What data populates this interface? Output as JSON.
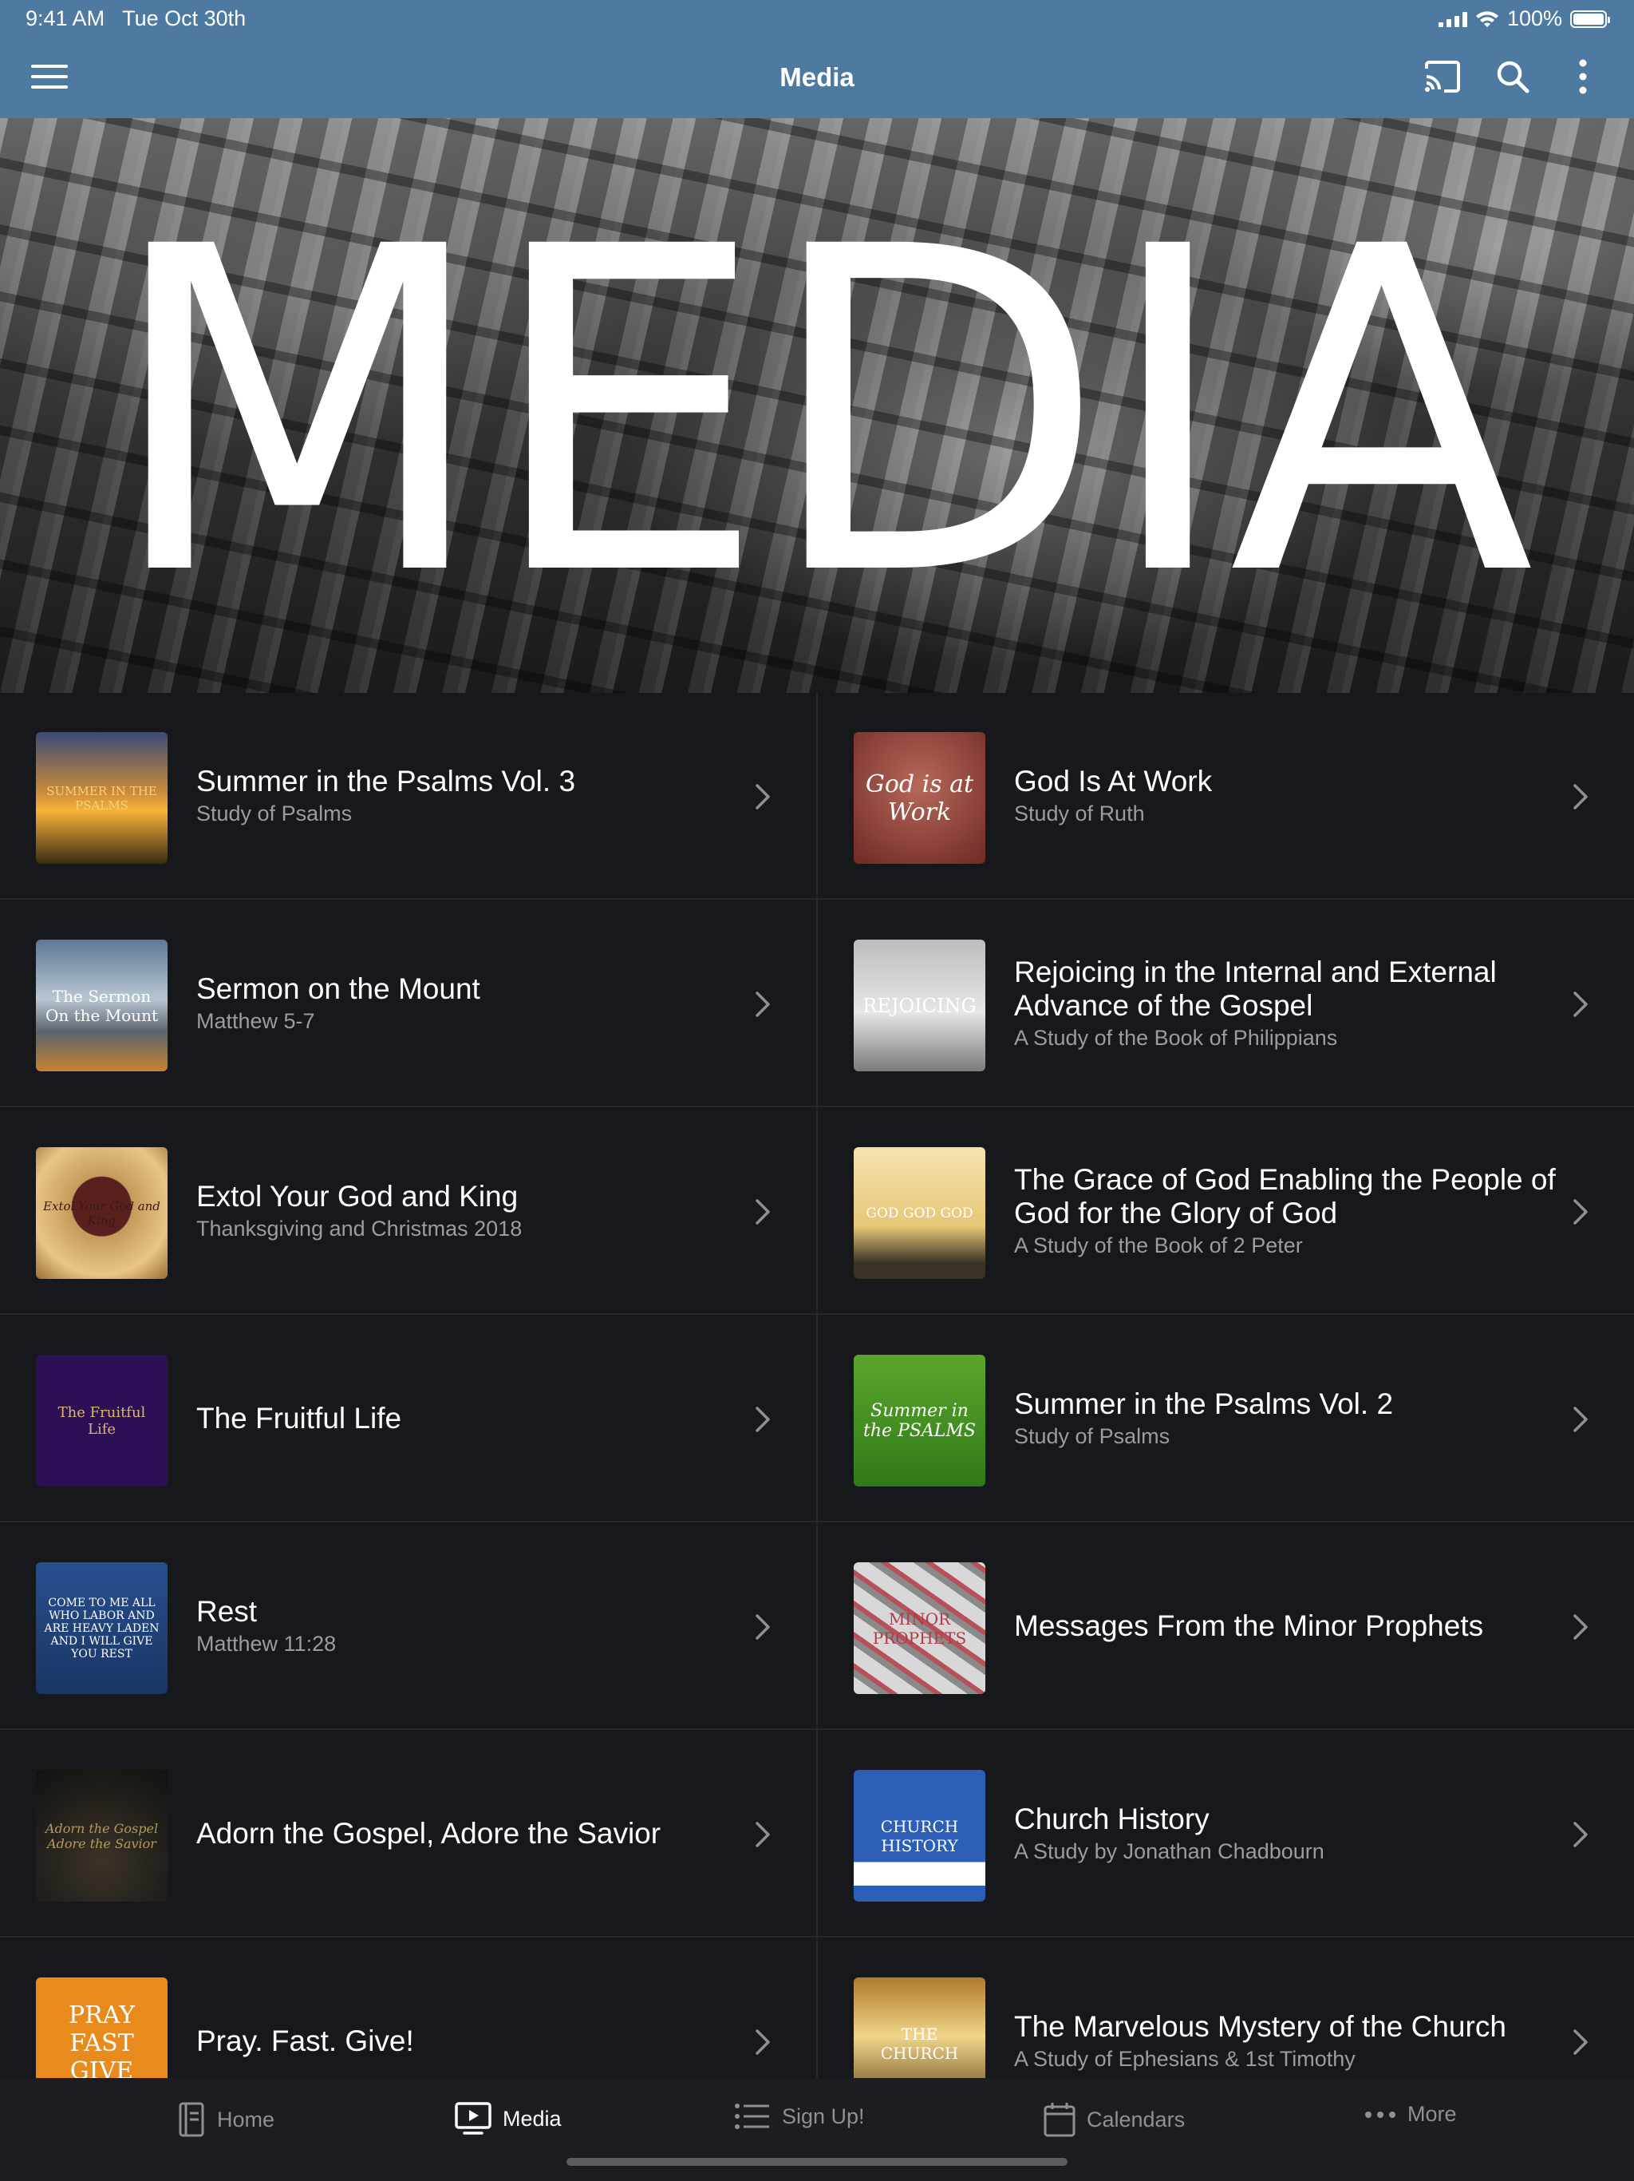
{
  "status": {
    "time": "9:41 AM",
    "date": "Tue Oct 30th",
    "battery": "100%",
    "battery_level": 1.0
  },
  "nav": {
    "title": "Media"
  },
  "hero": {
    "text": "MEDIA"
  },
  "items": [
    {
      "title": "Summer in the Psalms Vol. 3",
      "subtitle": "Study of Psalms",
      "thumb_text": "SUMMER IN THE PSALMS"
    },
    {
      "title": "God Is At Work",
      "subtitle": "Study of Ruth",
      "thumb_text": "God is at Work"
    },
    {
      "title": "Sermon on the Mount",
      "subtitle": "Matthew 5-7",
      "thumb_text": "The Sermon On the Mount"
    },
    {
      "title": "Rejoicing in the Internal and External Advance of the Gospel",
      "subtitle": "A Study of the Book of Philippians",
      "thumb_text": "REJOICING"
    },
    {
      "title": "Extol Your God and King",
      "subtitle": "Thanksgiving and Christmas 2018",
      "thumb_text": "Extol Your God and King"
    },
    {
      "title": "The Grace of God Enabling the People of God for the Glory of God",
      "subtitle": "A Study of the Book of 2 Peter",
      "thumb_text": "GOD GOD GOD"
    },
    {
      "title": "The Fruitful Life",
      "subtitle": "",
      "thumb_text": "The Fruitful Life"
    },
    {
      "title": "Summer in the Psalms Vol. 2",
      "subtitle": "Study of Psalms",
      "thumb_text": "Summer in the PSALMS"
    },
    {
      "title": "Rest",
      "subtitle": "Matthew 11:28",
      "thumb_text": "COME TO ME ALL WHO LABOR AND ARE HEAVY LADEN AND I WILL GIVE YOU REST"
    },
    {
      "title": "Messages From the Minor Prophets",
      "subtitle": "",
      "thumb_text": "MINOR PROPHETS"
    },
    {
      "title": "Adorn the Gospel, Adore the Savior",
      "subtitle": "",
      "thumb_text": "Adorn the Gospel Adore the Savior"
    },
    {
      "title": "Church History",
      "subtitle": "A Study by Jonathan Chadbourn",
      "thumb_text": "CHURCH HISTORY"
    },
    {
      "title": "Pray. Fast. Give!",
      "subtitle": "",
      "thumb_text": "PRAY FAST GIVE"
    },
    {
      "title": "The Marvelous Mystery of the Church",
      "subtitle": "A Study of Ephesians & 1st Timothy",
      "thumb_text": "THE CHURCH"
    }
  ],
  "tabs": [
    {
      "label": "Home",
      "icon": "book-icon"
    },
    {
      "label": "Media",
      "icon": "tv-play-icon",
      "active": true
    },
    {
      "label": "Sign Up!",
      "icon": "list-icon"
    },
    {
      "label": "Calendars",
      "icon": "calendar-icon"
    },
    {
      "label": "More",
      "icon": "more-dots-icon"
    }
  ],
  "colors": {
    "nav_bar": "#4e7aa1",
    "background": "#17181b",
    "tab_bar": "#1c1d20",
    "subtitle": "#9a9ca1"
  }
}
